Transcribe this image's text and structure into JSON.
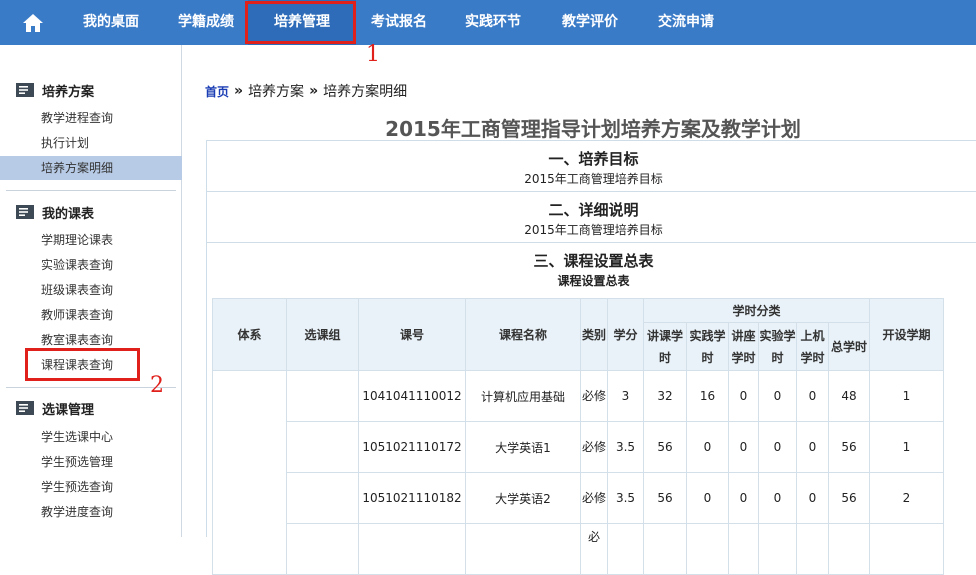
{
  "nav": {
    "items": [
      "我的桌面",
      "学籍成绩",
      "培养管理",
      "考试报名",
      "实践环节",
      "教学评价",
      "交流申请"
    ],
    "annotation1": "1",
    "annotation2": "2"
  },
  "sidebar": {
    "groups": [
      {
        "title": "培养方案",
        "items": [
          "教学进程查询",
          "执行计划",
          "培养方案明细"
        ]
      },
      {
        "title": "我的课表",
        "items": [
          "学期理论课表",
          "实验课表查询",
          "班级课表查询",
          "教师课表查询",
          "教室课表查询",
          "课程课表查询"
        ]
      },
      {
        "title": "选课管理",
        "items": [
          "学生选课中心",
          "学生预选管理",
          "学生预选查询",
          "教学进度查询"
        ]
      }
    ]
  },
  "breadcrumb": {
    "home": "首页",
    "sep": "»",
    "level1": "培养方案",
    "level2": "培养方案明细"
  },
  "main_title": "2015年工商管理指导计划培养方案及教学计划",
  "sections": [
    {
      "title": "一、培养目标",
      "sub": "2015年工商管理培养目标"
    },
    {
      "title": "二、详细说明",
      "sub": "2015年工商管理培养目标"
    },
    {
      "title": "三、课程设置总表",
      "sub": "课程设置总表"
    }
  ],
  "table": {
    "headers": {
      "system": "体系",
      "group": "选课组",
      "code": "课号",
      "name": "课程名称",
      "type": "类别",
      "credit": "学分",
      "hours_group": "学时分类",
      "lecture": "讲课学时",
      "practice": "实践学时",
      "seminar": "讲座学时",
      "experiment": "实验学时",
      "computer": "上机学时",
      "total": "总学时",
      "term": "开设学期"
    },
    "rows": [
      {
        "code": "1041041110012",
        "name": "计算机应用基础",
        "type": "必修",
        "credit": "3",
        "lecture": "32",
        "practice": "16",
        "seminar": "0",
        "experiment": "0",
        "computer": "0",
        "total": "48",
        "term": "1"
      },
      {
        "code": "1051021110172",
        "name": "大学英语1",
        "type": "必修",
        "credit": "3.5",
        "lecture": "56",
        "practice": "0",
        "seminar": "0",
        "experiment": "0",
        "computer": "0",
        "total": "56",
        "term": "1"
      },
      {
        "code": "1051021110182",
        "name": "大学英语2",
        "type": "必修",
        "credit": "3.5",
        "lecture": "56",
        "practice": "0",
        "seminar": "0",
        "experiment": "0",
        "computer": "0",
        "total": "56",
        "term": "2"
      },
      {
        "code": "",
        "name": "",
        "type": "必",
        "credit": "",
        "lecture": "",
        "practice": "",
        "seminar": "",
        "experiment": "",
        "computer": "",
        "total": "",
        "term": ""
      }
    ]
  },
  "colors": {
    "nav_bg": "#3a7bc8",
    "nav_active": "#2e6bb8",
    "highlight_red": "#e0201b",
    "sidebar_active": "#b8cbe6"
  },
  "icons": {
    "home": "home-icon",
    "group": "menu-list-icon"
  }
}
